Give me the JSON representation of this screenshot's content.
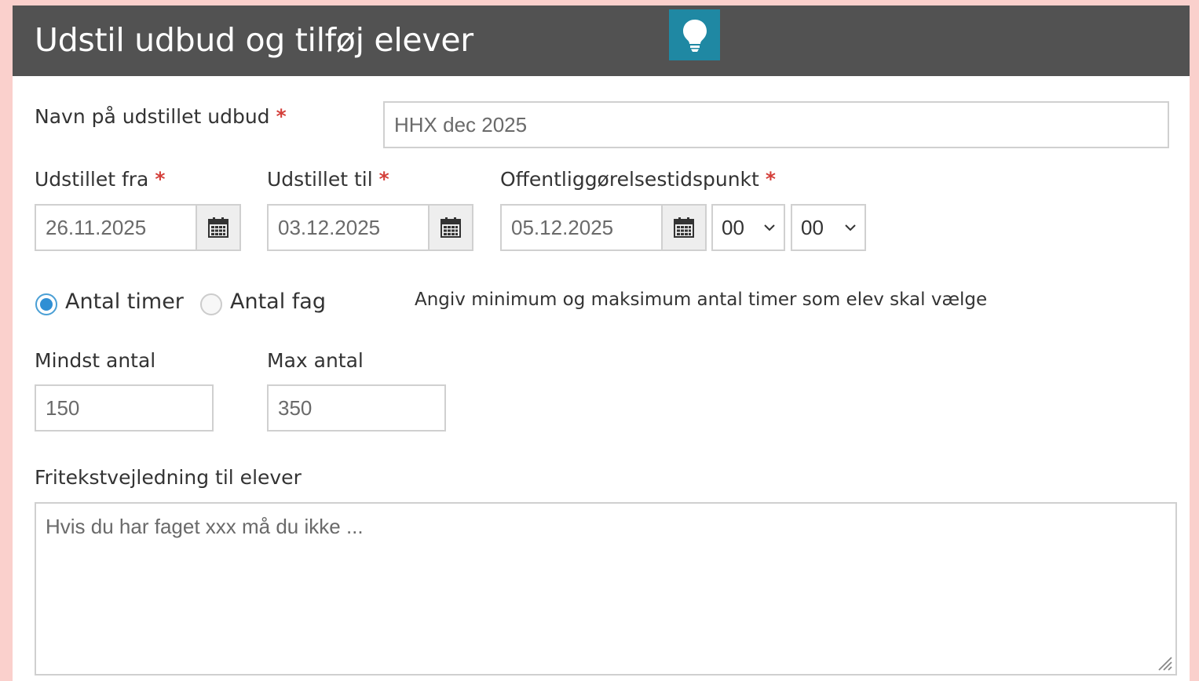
{
  "header": {
    "title": "Udstil udbud og tilføj elever",
    "help_icon": "lightbulb-icon",
    "help_color": "#1f88a3"
  },
  "form": {
    "name": {
      "label": "Navn på udstillet udbud",
      "required": "*",
      "value": "HHX dec 2025"
    },
    "from": {
      "label": "Udstillet fra",
      "required": "*",
      "value": "26.11.2025",
      "icon": "calendar-icon"
    },
    "to": {
      "label": "Udstillet til",
      "required": "*",
      "value": "03.12.2025",
      "icon": "calendar-icon"
    },
    "publish": {
      "label": "Offentliggørelsestidspunkt",
      "required": "*",
      "value": "05.12.2025",
      "icon": "calendar-icon",
      "hour": "00",
      "minute": "00"
    },
    "mode": {
      "option_hours": "Antal timer",
      "option_subjects": "Antal fag",
      "selected": "Antal timer",
      "hint": "Angiv minimum og maksimum antal timer som elev skal vælge"
    },
    "min": {
      "label": "Mindst antal",
      "value": "150"
    },
    "max": {
      "label": "Max antal",
      "value": "350"
    },
    "guidance": {
      "label": "Fritekstvejledning til elever",
      "placeholder": "Hvis du har faget xxx må du ikke ..."
    }
  },
  "colors": {
    "background": "#fad0cc",
    "header": "#525252",
    "required": "#d43f3a",
    "radio_accent": "#2f8fd4"
  }
}
